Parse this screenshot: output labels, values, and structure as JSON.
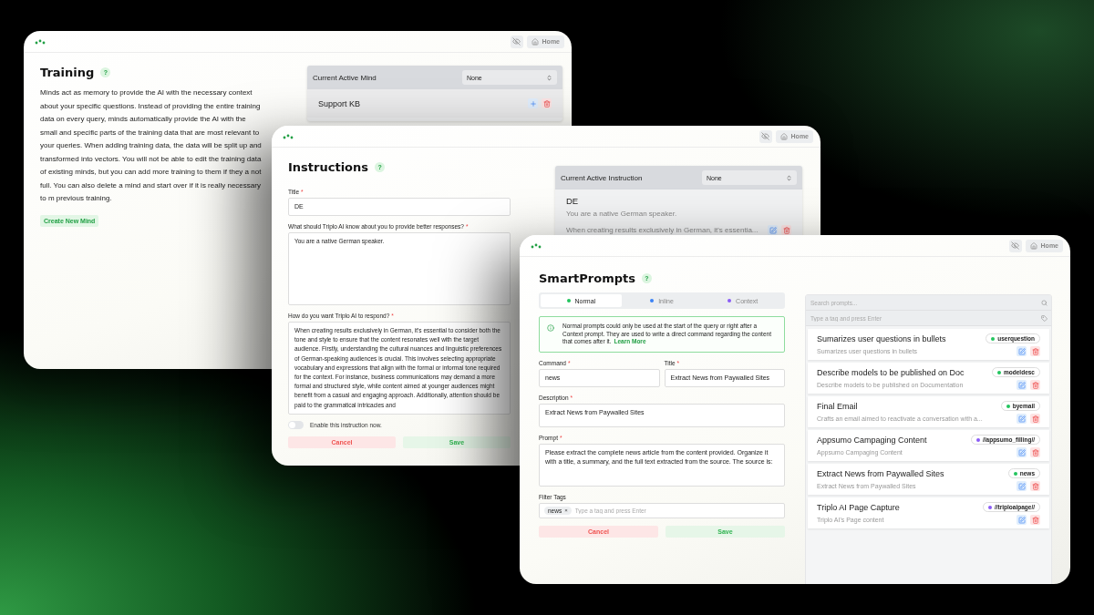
{
  "training_window": {
    "nav": {
      "home": "Home"
    },
    "title": "Training",
    "help": "?",
    "description": "Minds act as memory to provide the AI with the necessary context about your specific questions. Instead of providing the entire training data on every query, minds automatically provide the AI with the small and specific parts of the training data that are most relevant to your queries. When adding training data, the data will be split up and transformed into vectors. You will not be able to edit the training data of existing minds, but you can add more training to them if they a not full. You can also delete a mind and start over if it is really necessary to m previous training.",
    "create_button": "Create New Mind",
    "active_select": {
      "label": "Current Active Mind",
      "value": "None"
    },
    "minds": [
      {
        "name": "Support KB"
      }
    ]
  },
  "instructions_window": {
    "nav": {
      "home": "Home"
    },
    "title": "Instructions",
    "help": "?",
    "fields": [
      {
        "kind": "input",
        "label": "Title",
        "mark": "*",
        "value": "DE"
      },
      {
        "kind": "textarea",
        "label": "What should Triplo AI know about you to provide better responses?",
        "mark": "*",
        "value": "You are a native German speaker."
      },
      {
        "kind": "textarea",
        "label": "How do you want Triplo AI to respond?",
        "mark": "*",
        "value": "When creating results exclusively in German, it's essential to consider both the tone and style to ensure that the content resonates well with the target audience. Firstly, understanding the cultural nuances and linguistic preferences of German-speaking audiences is crucial. This involves selecting appropriate vocabulary and expressions that align with the formal or informal tone required for the context. For instance, business communications may demand a more formal and structured style, while content aimed at younger audiences might benefit from a casual and engaging approach. Additionally, attention should be paid to the grammatical intricacies and"
      }
    ],
    "toggle": {
      "label": "Enable this instruction now.",
      "on": false
    },
    "cancel": "Cancel",
    "save": "Save",
    "active_select": {
      "label": "Current Active Instruction",
      "value": "None"
    },
    "instructions": [
      {
        "title": "DE",
        "summary": "You are a native German speaker.",
        "detail": "When creating results exclusively in German, it's essentia..."
      }
    ]
  },
  "smartprompts_window": {
    "nav": {
      "home": "Home"
    },
    "title": "SmartPrompts",
    "help": "?",
    "tabs": [
      {
        "label": "Normal",
        "selected": true,
        "color": "#22c55e"
      },
      {
        "label": "Inline",
        "selected": false,
        "color": "#3b82f6"
      },
      {
        "label": "Context",
        "selected": false,
        "color": "#8b5cf6"
      }
    ],
    "notice": {
      "text": "Normal prompts could only be used at the start of the query or right after a Context prompt. They are used to write a direct command regarding the content that comes after it.",
      "link": "Learn More"
    },
    "command": {
      "label": "Command",
      "mark": "*",
      "value": "news"
    },
    "title_field": {
      "label": "Title",
      "mark": "*",
      "value": "Extract News from Paywalled Sites"
    },
    "description": {
      "label": "Description",
      "mark": "*",
      "value": "Extract News from Paywalled Sites"
    },
    "prompt": {
      "label": "Prompt",
      "mark": "*",
      "value": "Please extract the complete news article from the content provided. Organize it with a title, a summary, and the full text extracted from the source. The source is:"
    },
    "filter_tags": {
      "label": "Filter Tags",
      "tags": [
        {
          "label": "news",
          "remove": "×"
        }
      ],
      "placeholder": "Type a tag and press Enter"
    },
    "cancel": "Cancel",
    "save": "Save",
    "search": {
      "placeholder": "Search prompts..."
    },
    "tag_filter": {
      "placeholder": "Type a tag and press Enter"
    },
    "prompts": [
      {
        "title": "Sumarizes user questions in bullets",
        "description": "Sumarizes user questions in bullets",
        "tag": "userquestion",
        "color": "#22c55e"
      },
      {
        "title": "Describe models to be published on Doc",
        "description": "Describe models to be published on Documentation",
        "tag": "modeldesc",
        "color": "#22c55e"
      },
      {
        "title": "Final Email",
        "description": "Crafts an email aimed to reactivate a conversation with a...",
        "tag": "byemail",
        "color": "#22c55e"
      },
      {
        "title": "Appsumo Campaging Content",
        "description": "Appsumo Campaging Content",
        "tag": "//appsumo_filling//",
        "color": "#8b5cf6"
      },
      {
        "title": "Extract News from Paywalled Sites",
        "description": "Extract News from Paywalled Sites",
        "tag": "news",
        "color": "#22c55e"
      },
      {
        "title": "Triplo AI Page Capture",
        "description": "Triplo AI's Page content",
        "tag": "//triploaipage//",
        "color": "#8b5cf6"
      }
    ]
  }
}
